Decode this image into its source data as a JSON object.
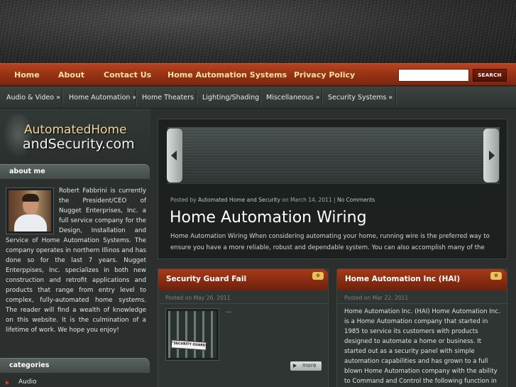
{
  "nav": {
    "items": [
      "Home",
      "About",
      "Contact Us",
      "Home Automation Systems",
      "Privacy Policy"
    ],
    "search_placeholder": "",
    "search_button": "SEARCH"
  },
  "subnav": {
    "items": [
      "Audio & Video »",
      "Home Automation »",
      "Home Theaters",
      "Lighting/Shading",
      "Miscellaneous »",
      "Security Systems »"
    ]
  },
  "logo": {
    "line1": "AutomatedHome",
    "line2": "andSecurity.com"
  },
  "about": {
    "title": "about me",
    "text": "Robert Fabbrini is currently the President/CEO of Nugget Enterprises, Inc. a full service company for the Design, Installation and Service of Home Automation Systems. The company operates in northern Illinos and has done so for the last 7 years. Nugget Enterppises, Inc. specializes in both new construction and retrofit applications and products that range from entry level to complex, fully-automated home systems. The reader will find a wealth of knowledge on this website. It is the culmination of a lifetime of work. We hope you enjoy!"
  },
  "categories": {
    "title": "categories",
    "items": [
      "Audio"
    ]
  },
  "featured": {
    "meta_prefix": "Posted by ",
    "author": "Automated Home and Security",
    "meta_date": " on March 14, 2011 | ",
    "comments": "No Comments",
    "title": "Home Automation Wiring",
    "excerpt": "Home Automation Wiring When considering automating your home, running wire is the preferred way to ensure you have a more reliable, robust and dependable system. You can also accomplish many of the"
  },
  "posts": [
    {
      "title": "Security Guard Fail",
      "comments": "0",
      "date": "Posted on May 26, 2011",
      "excerpt": "...",
      "more": "more",
      "thumb_sign": "\"SECURITY GUARD\""
    },
    {
      "title": "Home Automation Inc (HAI)",
      "comments": "0",
      "date": "Posted on Mar 22, 2011",
      "excerpt": "Home Automation Inc. (HAI) Home Automation Inc. is a Home Automation company that started in 1985 to service its customers with products designed to automate a home or business. It started out as a security panel with simple automation capabilities and has grown to a full blown Home Automation company with the ability to Command and Control the following function in"
    }
  ]
}
